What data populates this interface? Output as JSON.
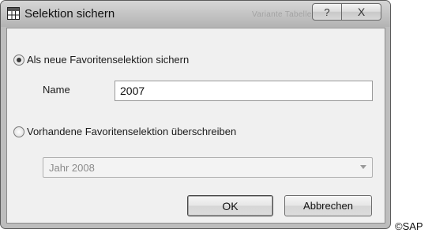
{
  "window": {
    "title": "Selektion sichern",
    "background_title_text": "Variante Tabelle ab  ...",
    "help_label": "?",
    "close_label": "X"
  },
  "options": {
    "new_selection_label": "Als neue Favoritenselektion sichern",
    "new_selection_checked": true,
    "name_label": "Name",
    "name_value": "2007",
    "overwrite_label": "Vorhandene Favoritenselektion überschreiben",
    "overwrite_checked": false,
    "existing_selection_value": "Jahr 2008"
  },
  "buttons": {
    "ok_label": "OK",
    "cancel_label": "Abbrechen"
  },
  "footer": {
    "copyright": "©SAP"
  },
  "colors": {
    "titlebar": "#c6c6c6",
    "client_background": "#f0f0f0",
    "disabled_text": "#8a8a8a"
  }
}
